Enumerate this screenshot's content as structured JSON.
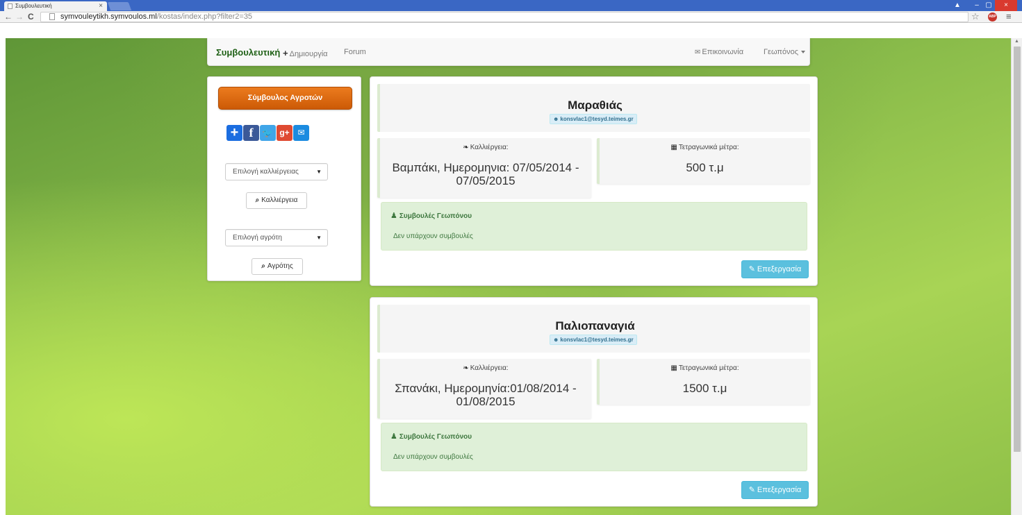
{
  "browser": {
    "tab_title": "Συμβουλευτική",
    "tab_close": "×",
    "url_host": "symvouleytikh.symvoulos.ml",
    "url_path": "/kostas/index.php?filter2=35",
    "back_icon": "←",
    "forward_icon": "→",
    "reload_icon": "C",
    "star_icon": "☆",
    "abp_label": "ABP",
    "menu_icon": "≡",
    "win_user_icon": "▲",
    "win_min_icon": "–",
    "win_max_icon": "▢",
    "win_close_icon": "×"
  },
  "navbar": {
    "brand": "Συμβουλευτική",
    "create_icon": "+",
    "create_label": "Δημιουργία",
    "forum_label": "Forum",
    "contact_icon": "✉",
    "contact_label": "Επικοινωνία",
    "user_label": "Γεωπόνος"
  },
  "sidebar": {
    "advisor_button": "Σύμβουλος Αγροτών",
    "share_icons": {
      "plus": "+",
      "facebook": "f",
      "twitter": "t",
      "gplus": "g+",
      "mail": "✉"
    },
    "crop_select": "Επιλογή καλλιέργειας",
    "crop_button": "Καλλιέργεια",
    "farmer_select": "Επιλογή αγρότη",
    "farmer_button": "Αγρότης",
    "search_icon": "🔍",
    "dropdown_arrow": "▼"
  },
  "labels": {
    "crop_label": "Καλλιέργεια:",
    "crop_icon": "🌿",
    "area_label": "Τετραγωνικά μέτρα:",
    "area_icon": "▦",
    "advice_title": "Συμβουλές Γεωπόνου",
    "advice_icon": "👥",
    "edit_button": "Επεξεργασία",
    "edit_icon": "✎",
    "person_icon": "👤"
  },
  "cards": [
    {
      "title": "Μαραθιάς",
      "email": "konsvlac1@tesyd.teimes.gr",
      "crop": "Βαμπάκι, Ημερομηνια: 07/05/2014 - 07/05/2015",
      "area": "500 τ.μ",
      "advice": "Δεν υπάρχουν συμβουλές"
    },
    {
      "title": "Παλιοπαναγιά",
      "email": "konsvlac1@tesyd.teimes.gr",
      "crop": "Σπανάκι, Ημερομηνία:01/08/2014 - 01/08/2015",
      "area": "1500 τ.μ",
      "advice": "Δεν υπάρχουν συμβουλές"
    }
  ],
  "colors": {
    "brand": "#1d5f14",
    "advisor_button": "#e26d12",
    "edit_button": "#5bc0de",
    "advice_bg": "#dff0d8",
    "background_green": "#8fc048"
  }
}
